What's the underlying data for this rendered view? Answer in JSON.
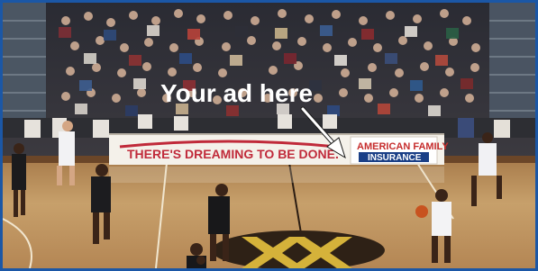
{
  "ad": {
    "label": "Your ad here"
  },
  "banner": {
    "slogan": "THERE'S DREAMING TO BE DONE.",
    "brand_top": "AMERICAN FAMILY",
    "brand_bottom": "INSURANCE"
  },
  "colors": {
    "frame": "#1b57a6",
    "court": "#c59a62",
    "banner_red": "#c02a3a",
    "logo_gold": "#d5b23a",
    "brand_blue": "#1a3f86"
  }
}
